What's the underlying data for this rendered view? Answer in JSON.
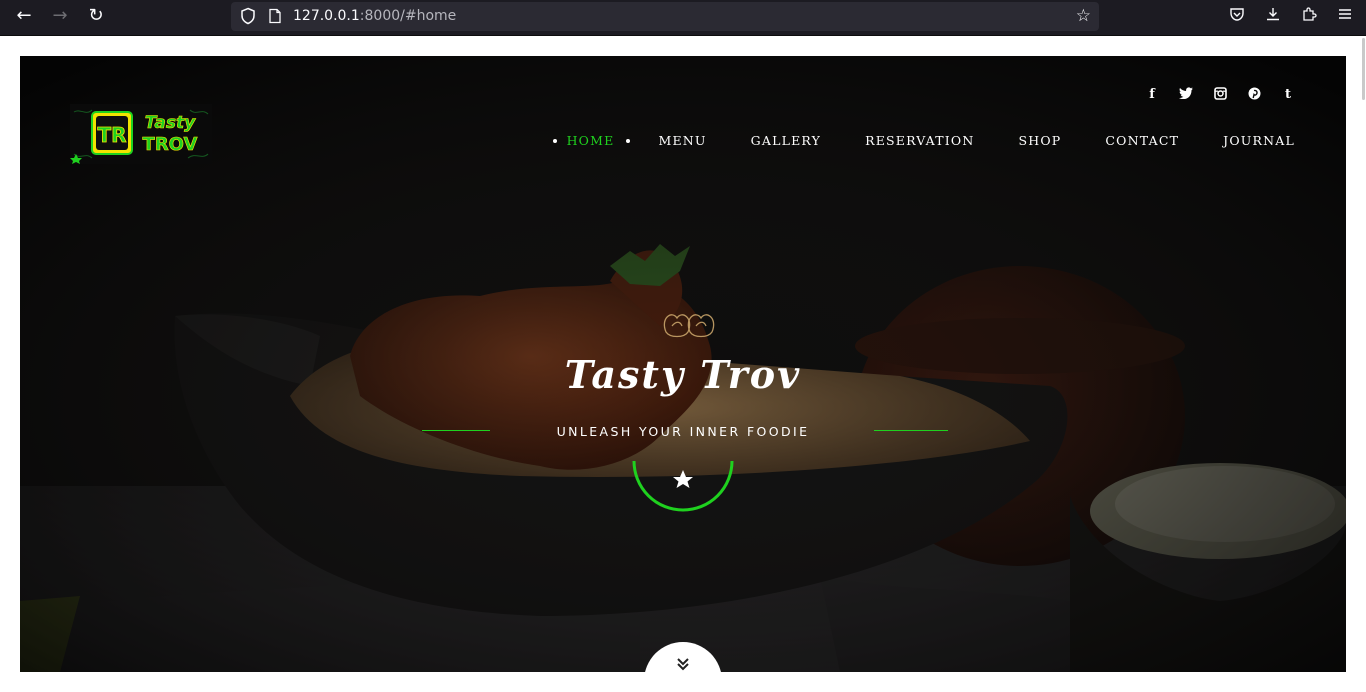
{
  "browser": {
    "url_host": "127.0.0.1",
    "url_rest": ":8000/#home",
    "icons": [
      "back-icon",
      "forward-icon",
      "reload-icon",
      "shield-icon",
      "page-icon",
      "bookmark-star-icon",
      "pocket-icon",
      "download-icon",
      "extensions-icon",
      "menu-icon"
    ]
  },
  "site": {
    "social": [
      "f",
      "t",
      "ig",
      "p",
      "t"
    ],
    "nav": [
      "HOME",
      "MENU",
      "GALLERY",
      "RESERVATION",
      "SHOP",
      "CONTACT",
      "JOURNAL"
    ],
    "title": "Tasty Trov",
    "tagline": "UNLEASH YOUR INNER FOODIE"
  },
  "colors": {
    "accent": "#1fd11f",
    "chrome_bg": "#1c1b22",
    "urlbar_bg": "#2b2a33",
    "ornament": "#c8a46a"
  }
}
